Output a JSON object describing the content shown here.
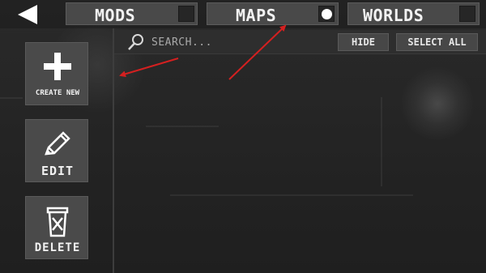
{
  "topbar": {
    "back_icon": "back-arrow-icon",
    "tabs": [
      {
        "label": "MODS",
        "selected": false
      },
      {
        "label": "MAPS",
        "selected": true
      },
      {
        "label": "WORLDS",
        "selected": false
      }
    ]
  },
  "sidebar": {
    "create_label": "CREATE NEW",
    "edit_label": "EDIT",
    "delete_label": "DELETE",
    "create_icon": "plus-icon",
    "edit_icon": "pencil-icon",
    "delete_icon": "trash-icon"
  },
  "search": {
    "icon": "search-icon",
    "placeholder": "SEARCH...",
    "value": ""
  },
  "actions": {
    "hide_label": "HIDE",
    "select_all_label": "SELECT ALL"
  },
  "colors": {
    "background": "#262626",
    "button": "#4a4a4a",
    "annotation_arrow": "#d42020"
  }
}
